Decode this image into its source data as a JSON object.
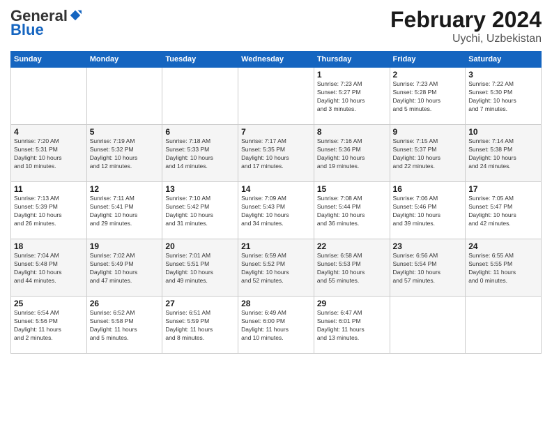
{
  "header": {
    "logo_general": "General",
    "logo_blue": "Blue",
    "month_title": "February 2024",
    "location": "Uychi, Uzbekistan"
  },
  "days_of_week": [
    "Sunday",
    "Monday",
    "Tuesday",
    "Wednesday",
    "Thursday",
    "Friday",
    "Saturday"
  ],
  "weeks": [
    [
      {
        "day": "",
        "info": ""
      },
      {
        "day": "",
        "info": ""
      },
      {
        "day": "",
        "info": ""
      },
      {
        "day": "",
        "info": ""
      },
      {
        "day": "1",
        "info": "Sunrise: 7:23 AM\nSunset: 5:27 PM\nDaylight: 10 hours\nand 3 minutes."
      },
      {
        "day": "2",
        "info": "Sunrise: 7:23 AM\nSunset: 5:28 PM\nDaylight: 10 hours\nand 5 minutes."
      },
      {
        "day": "3",
        "info": "Sunrise: 7:22 AM\nSunset: 5:30 PM\nDaylight: 10 hours\nand 7 minutes."
      }
    ],
    [
      {
        "day": "4",
        "info": "Sunrise: 7:20 AM\nSunset: 5:31 PM\nDaylight: 10 hours\nand 10 minutes."
      },
      {
        "day": "5",
        "info": "Sunrise: 7:19 AM\nSunset: 5:32 PM\nDaylight: 10 hours\nand 12 minutes."
      },
      {
        "day": "6",
        "info": "Sunrise: 7:18 AM\nSunset: 5:33 PM\nDaylight: 10 hours\nand 14 minutes."
      },
      {
        "day": "7",
        "info": "Sunrise: 7:17 AM\nSunset: 5:35 PM\nDaylight: 10 hours\nand 17 minutes."
      },
      {
        "day": "8",
        "info": "Sunrise: 7:16 AM\nSunset: 5:36 PM\nDaylight: 10 hours\nand 19 minutes."
      },
      {
        "day": "9",
        "info": "Sunrise: 7:15 AM\nSunset: 5:37 PM\nDaylight: 10 hours\nand 22 minutes."
      },
      {
        "day": "10",
        "info": "Sunrise: 7:14 AM\nSunset: 5:38 PM\nDaylight: 10 hours\nand 24 minutes."
      }
    ],
    [
      {
        "day": "11",
        "info": "Sunrise: 7:13 AM\nSunset: 5:39 PM\nDaylight: 10 hours\nand 26 minutes."
      },
      {
        "day": "12",
        "info": "Sunrise: 7:11 AM\nSunset: 5:41 PM\nDaylight: 10 hours\nand 29 minutes."
      },
      {
        "day": "13",
        "info": "Sunrise: 7:10 AM\nSunset: 5:42 PM\nDaylight: 10 hours\nand 31 minutes."
      },
      {
        "day": "14",
        "info": "Sunrise: 7:09 AM\nSunset: 5:43 PM\nDaylight: 10 hours\nand 34 minutes."
      },
      {
        "day": "15",
        "info": "Sunrise: 7:08 AM\nSunset: 5:44 PM\nDaylight: 10 hours\nand 36 minutes."
      },
      {
        "day": "16",
        "info": "Sunrise: 7:06 AM\nSunset: 5:46 PM\nDaylight: 10 hours\nand 39 minutes."
      },
      {
        "day": "17",
        "info": "Sunrise: 7:05 AM\nSunset: 5:47 PM\nDaylight: 10 hours\nand 42 minutes."
      }
    ],
    [
      {
        "day": "18",
        "info": "Sunrise: 7:04 AM\nSunset: 5:48 PM\nDaylight: 10 hours\nand 44 minutes."
      },
      {
        "day": "19",
        "info": "Sunrise: 7:02 AM\nSunset: 5:49 PM\nDaylight: 10 hours\nand 47 minutes."
      },
      {
        "day": "20",
        "info": "Sunrise: 7:01 AM\nSunset: 5:51 PM\nDaylight: 10 hours\nand 49 minutes."
      },
      {
        "day": "21",
        "info": "Sunrise: 6:59 AM\nSunset: 5:52 PM\nDaylight: 10 hours\nand 52 minutes."
      },
      {
        "day": "22",
        "info": "Sunrise: 6:58 AM\nSunset: 5:53 PM\nDaylight: 10 hours\nand 55 minutes."
      },
      {
        "day": "23",
        "info": "Sunrise: 6:56 AM\nSunset: 5:54 PM\nDaylight: 10 hours\nand 57 minutes."
      },
      {
        "day": "24",
        "info": "Sunrise: 6:55 AM\nSunset: 5:55 PM\nDaylight: 11 hours\nand 0 minutes."
      }
    ],
    [
      {
        "day": "25",
        "info": "Sunrise: 6:54 AM\nSunset: 5:56 PM\nDaylight: 11 hours\nand 2 minutes."
      },
      {
        "day": "26",
        "info": "Sunrise: 6:52 AM\nSunset: 5:58 PM\nDaylight: 11 hours\nand 5 minutes."
      },
      {
        "day": "27",
        "info": "Sunrise: 6:51 AM\nSunset: 5:59 PM\nDaylight: 11 hours\nand 8 minutes."
      },
      {
        "day": "28",
        "info": "Sunrise: 6:49 AM\nSunset: 6:00 PM\nDaylight: 11 hours\nand 10 minutes."
      },
      {
        "day": "29",
        "info": "Sunrise: 6:47 AM\nSunset: 6:01 PM\nDaylight: 11 hours\nand 13 minutes."
      },
      {
        "day": "",
        "info": ""
      },
      {
        "day": "",
        "info": ""
      }
    ]
  ]
}
